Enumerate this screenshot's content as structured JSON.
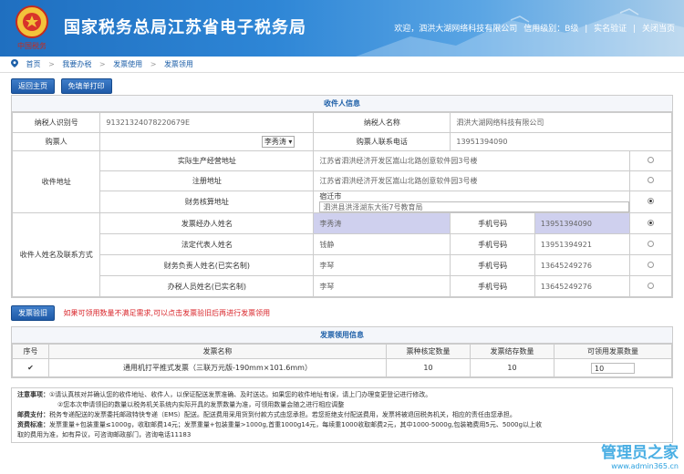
{
  "header": {
    "title": "国家税务总局江苏省电子税务局",
    "emblem_text": "中国税务",
    "welcome": "欢迎，泗洪大湖网络科技有限公司",
    "credit": "信用级别：B级",
    "realname": "实名验证",
    "close": "关闭当页",
    "sep": "|"
  },
  "breadcrumb": [
    "首页",
    ">",
    "我要办税",
    ">",
    "发票使用",
    ">",
    "发票领用"
  ],
  "toolbar": {
    "back": "返回主页",
    "print": "免填单打印"
  },
  "recipient": {
    "title": "收件人信息",
    "taxpayer_id_label": "纳税人识别号",
    "taxpayer_id": "91321324078220679E",
    "taxpayer_name_label": "纳税人名称",
    "taxpayer_name": "泗洪大湖网络科技有限公司",
    "buyer_label": "购票人",
    "buyer_value": "李秀涛 ▾",
    "buyer_phone_label": "购票人联系电话",
    "buyer_phone": "13951394090",
    "address_label": "收件地址",
    "addr_rows": [
      {
        "label": "实际生产经营地址",
        "value": "江苏省泗洪经济开发区嵩山北路创意软件园3号楼"
      },
      {
        "label": "注册地址",
        "value": "江苏省泗洪经济开发区嵩山北路创意软件园3号楼"
      },
      {
        "label": "财务核算地址",
        "prefix": "宿迁市",
        "value": "泗洪县洪泽湖东大街7号教育局"
      }
    ],
    "contact_label": "收件人姓名及联系方式",
    "phone_label": "手机号码",
    "contacts": [
      {
        "role": "发票经办人姓名",
        "name": "李秀涛",
        "phone": "13951394090"
      },
      {
        "role": "法定代表人姓名",
        "name": "钱静",
        "phone": "13951394921"
      },
      {
        "role": "财务负责人姓名(已实名制)",
        "name": "李琴",
        "phone": "13645249276"
      },
      {
        "role": "办税人员姓名(已实名制)",
        "name": "李琴",
        "phone": "13645249276"
      }
    ]
  },
  "verify": {
    "button": "发票验旧",
    "hint": "如果可领用数量不满足需求,可以点击发票验旧后再进行发票领用"
  },
  "invoice": {
    "title": "发票领用信息",
    "headers": [
      "序号",
      "发票名称",
      "票种核定数量",
      "发票结存数量",
      "可领用发票数量"
    ],
    "rows": [
      {
        "checked": "✔",
        "name": "通用机打平推式发票（三联万元版-190mm×101.6mm）",
        "approved": "10",
        "stock": "10",
        "available": "10"
      }
    ]
  },
  "notes": {
    "n1_label": "注意事项：",
    "n1": "①请认真核对并确认您的收件地址、收件人，以保证配送发票准确、及时送达。如果您的收件地址有误，请上门办理变更登记进行修改。",
    "n2": "②您本次申请领旧的数量以税务机关系统内实际开具的发票数量为准，可领用数量会随之进行相应调整",
    "n3_label": "邮费支付：",
    "n3": "税务专递配送的发票委托邮政特快专递（EMS）配送。配送费用采用货到付款方式由您承担。若您拒绝支付配送费用，发票将被退回税务机关，相应的责任由您承担。",
    "n4_label": "资费标准：",
    "n4": "发票重量+包装重量≤1000g，收取邮费14元；发票重量+包装重量>1000g,首重1000g14元，每续重1000收取邮费2元，其中1000-5000g,包装箱费用5元、5000g以上收",
    "n5": "取的费用为准，如有异议，可咨询邮政部门，咨询电话11183"
  },
  "watermark": {
    "line1": "管理员之家",
    "line2": "www.admin365.cn"
  }
}
